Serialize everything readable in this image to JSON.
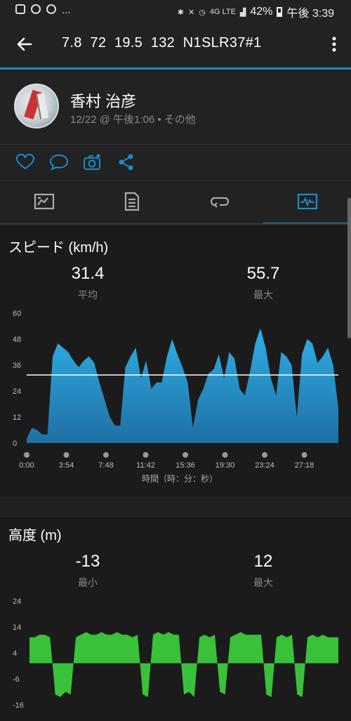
{
  "status_bar": {
    "battery": "42%",
    "time": "午後 3:39",
    "network": "4G LTE",
    "dots": "..."
  },
  "header": {
    "title": "7.8  72  19.5  132  N1SLR37#1",
    "back_icon": "arrow-left-icon",
    "menu_icon": "more-vert-icon"
  },
  "profile": {
    "name": "香村 治彦",
    "meta": "12/22 @ 午後1:06 • その他"
  },
  "actions": [
    "heart-icon",
    "comment-icon",
    "camera-add-icon",
    "share-icon"
  ],
  "tabs": [
    {
      "icon": "map-icon",
      "active": false
    },
    {
      "icon": "list-doc-icon",
      "active": false
    },
    {
      "icon": "laps-icon",
      "active": false
    },
    {
      "icon": "chart-icon",
      "active": true
    }
  ],
  "accent_color": "#1a8cc8",
  "speed_section": {
    "title": "スピード (km/h)",
    "avg_value": "31.4",
    "avg_label": "平均",
    "max_value": "55.7",
    "max_label": "最大"
  },
  "elevation_section": {
    "title": "高度 (m)",
    "min_value": "-13",
    "min_label": "最小",
    "max_value": "12",
    "max_label": "最大"
  },
  "chart_data": [
    {
      "type": "area",
      "title": "スピード (km/h)",
      "xlabel": "時間（時：分：秒）",
      "ylabel": "",
      "ylim": [
        0,
        60
      ],
      "yticks": [
        "0",
        "12",
        "24",
        "36",
        "48",
        "60"
      ],
      "xticks": [
        "0:00",
        "3:54",
        "7:48",
        "11:42",
        "15:36",
        "19:30",
        "23:24",
        "27:18"
      ],
      "x_minutes": [
        0,
        0.5,
        1,
        1.5,
        2,
        2.5,
        3,
        3.5,
        4,
        4.5,
        5,
        5.5,
        6,
        6.5,
        7,
        7.5,
        8,
        8.5,
        9,
        9.5,
        10,
        10.5,
        11,
        11.5,
        12,
        12.5,
        13,
        13.5,
        14,
        14.5,
        15,
        15.5,
        16,
        16.5,
        17,
        17.5,
        18,
        18.5,
        19,
        19.5,
        20,
        20.5,
        21,
        21.5,
        22,
        22.5,
        23,
        23.5,
        24,
        24.5,
        25,
        25.5,
        26,
        26.5,
        27,
        27.5,
        28,
        28.5,
        29,
        29.5,
        30
      ],
      "values": [
        2,
        7,
        6,
        4,
        4,
        40,
        46,
        44,
        42,
        38,
        35,
        38,
        40,
        37,
        28,
        20,
        12,
        8,
        8,
        35,
        40,
        44,
        30,
        38,
        25,
        28,
        28,
        40,
        48,
        41,
        35,
        28,
        7,
        20,
        25,
        32,
        34,
        41,
        30,
        42,
        39,
        25,
        22,
        33,
        46,
        53,
        44,
        30,
        22,
        42,
        40,
        36,
        12,
        41,
        48,
        46,
        37,
        40,
        44,
        36,
        16
      ],
      "average_line": 31.4,
      "color": "#1a8cc8"
    },
    {
      "type": "area",
      "title": "高度 (m)",
      "xlabel": "",
      "ylabel": "",
      "ylim": [
        -16,
        24
      ],
      "yticks": [
        "-16",
        "-6",
        "4",
        "14",
        "24"
      ],
      "x_minutes": [
        0,
        0.5,
        1,
        1.5,
        2,
        2.5,
        3,
        3.5,
        4,
        4.5,
        5,
        5.5,
        6,
        6.5,
        7,
        7.5,
        8,
        8.5,
        9,
        9.5,
        10,
        10.5,
        11,
        11.5,
        12,
        12.5,
        13,
        13.5,
        14,
        14.5,
        15,
        15.5,
        16,
        16.5,
        17,
        17.5,
        18,
        18.5,
        19,
        19.5,
        20,
        20.5,
        21,
        21.5,
        22,
        22.5,
        23,
        23.5,
        24,
        24.5,
        25,
        25.5,
        26,
        26.5,
        27,
        27.5,
        28,
        28.5,
        29,
        29.5,
        30
      ],
      "values": [
        10,
        10,
        11,
        11,
        10,
        -12,
        -13,
        -11,
        -12,
        10,
        11,
        12,
        11,
        11,
        12,
        11,
        11,
        12,
        11,
        11,
        10,
        11,
        -12,
        -13,
        11,
        12,
        11,
        12,
        11,
        11,
        -12,
        -11,
        -13,
        10,
        11,
        10,
        11,
        -11,
        -12,
        10,
        11,
        12,
        11,
        11,
        11,
        11,
        -12,
        -13,
        10,
        11,
        10,
        11,
        -12,
        -13,
        10,
        11,
        10,
        11,
        10,
        10,
        10
      ],
      "color": "#39c13a"
    }
  ]
}
